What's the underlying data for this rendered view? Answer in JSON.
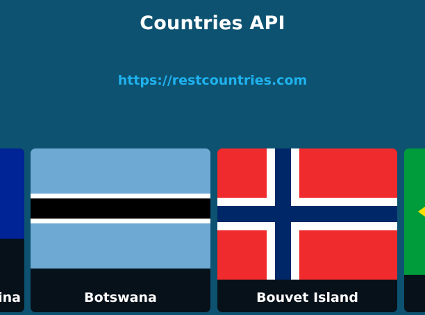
{
  "header": {
    "title": "Countries API",
    "link_text": "https://restcountries.com"
  },
  "cards": [
    {
      "name": "ina",
      "flag_color": "#002395"
    },
    {
      "name": "Botswana",
      "flag_colors": [
        "#6da9d2",
        "#ffffff",
        "#000000"
      ]
    },
    {
      "name": "Bouvet Island",
      "flag_colors": [
        "#ef2b2d",
        "#ffffff",
        "#002868"
      ]
    },
    {
      "name": "",
      "flag_colors": [
        "#009c3b",
        "#ffdf00"
      ]
    }
  ]
}
